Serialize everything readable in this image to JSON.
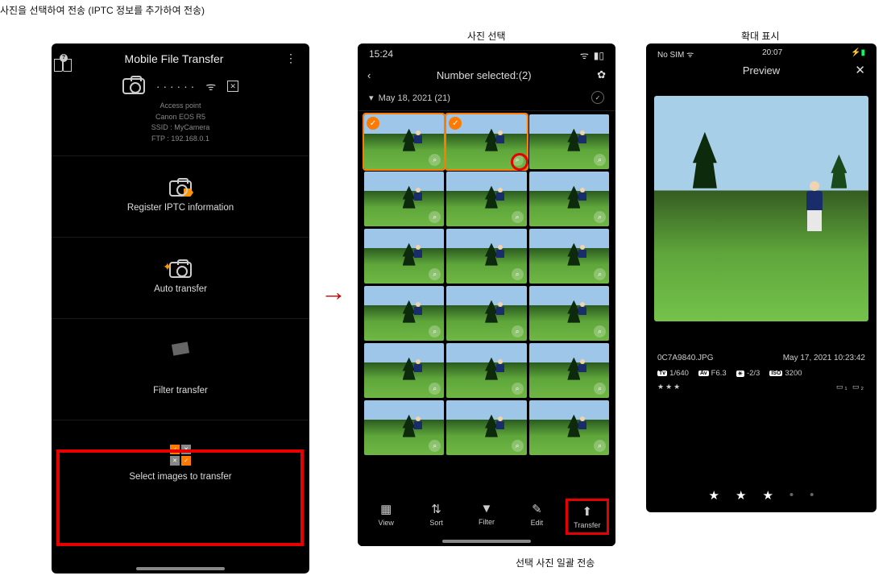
{
  "captions": {
    "top_left": "사진을 선택하여 전송 (IPTC 정보를 추가하여 전송)",
    "p2_top": "사진 선택",
    "p3_top": "확대 표시",
    "p2_bottom": "선택 사진 일괄 전송"
  },
  "phone1": {
    "title": "Mobile File Transfer",
    "dots": "· · · · · ·",
    "info_label": "Access point",
    "camera": "Canon EOS R5",
    "ssid": "SSID : MyCamera",
    "ftp": "FTP : 192.168.0.1",
    "tile_iptc": "Register IPTC information",
    "tile_auto": "Auto transfer",
    "tile_filter": "Filter transfer",
    "tile_select": "Select images to transfer"
  },
  "phone2": {
    "time": "15:24",
    "title": "Number selected:(2)",
    "date_group": "May 18, 2021 (21)",
    "bottom": {
      "view": "View",
      "sort": "Sort",
      "filter": "Filter",
      "edit": "Edit",
      "transfer": "Transfer"
    }
  },
  "phone3": {
    "carrier": "No SIM",
    "time": "20:07",
    "title": "Preview",
    "filename": "0C7A9840.JPG",
    "datetime": "May 17, 2021 10:23:42",
    "tv_label": "Tv",
    "tv": "1/640",
    "av_label": "Av",
    "av": "F6.3",
    "ev_label": "",
    "ev": "-2/3",
    "iso_label": "ISO",
    "iso": "3200",
    "rating3": "★★★"
  }
}
